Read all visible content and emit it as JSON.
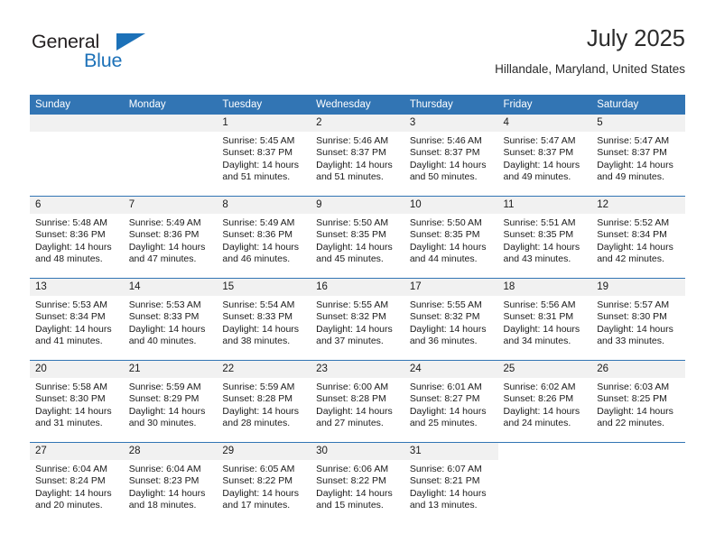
{
  "brand": {
    "name_part1": "General",
    "name_part2": "Blue",
    "triangle_icon": "triangle-icon",
    "accent_color": "#1c71b8"
  },
  "header": {
    "title": "July 2025",
    "subtitle": "Hillandale, Maryland, United States"
  },
  "calendar": {
    "header_bg": "#3275b4",
    "daynum_bg": "#f1f1f1",
    "weekdays": [
      "Sunday",
      "Monday",
      "Tuesday",
      "Wednesday",
      "Thursday",
      "Friday",
      "Saturday"
    ],
    "weeks": [
      [
        {
          "day": "",
          "sunrise": "",
          "sunset": "",
          "daylight": "",
          "empty": true
        },
        {
          "day": "",
          "sunrise": "",
          "sunset": "",
          "daylight": "",
          "empty": true
        },
        {
          "day": "1",
          "sunrise": "Sunrise: 5:45 AM",
          "sunset": "Sunset: 8:37 PM",
          "daylight": "Daylight: 14 hours and 51 minutes."
        },
        {
          "day": "2",
          "sunrise": "Sunrise: 5:46 AM",
          "sunset": "Sunset: 8:37 PM",
          "daylight": "Daylight: 14 hours and 51 minutes."
        },
        {
          "day": "3",
          "sunrise": "Sunrise: 5:46 AM",
          "sunset": "Sunset: 8:37 PM",
          "daylight": "Daylight: 14 hours and 50 minutes."
        },
        {
          "day": "4",
          "sunrise": "Sunrise: 5:47 AM",
          "sunset": "Sunset: 8:37 PM",
          "daylight": "Daylight: 14 hours and 49 minutes."
        },
        {
          "day": "5",
          "sunrise": "Sunrise: 5:47 AM",
          "sunset": "Sunset: 8:37 PM",
          "daylight": "Daylight: 14 hours and 49 minutes."
        }
      ],
      [
        {
          "day": "6",
          "sunrise": "Sunrise: 5:48 AM",
          "sunset": "Sunset: 8:36 PM",
          "daylight": "Daylight: 14 hours and 48 minutes."
        },
        {
          "day": "7",
          "sunrise": "Sunrise: 5:49 AM",
          "sunset": "Sunset: 8:36 PM",
          "daylight": "Daylight: 14 hours and 47 minutes."
        },
        {
          "day": "8",
          "sunrise": "Sunrise: 5:49 AM",
          "sunset": "Sunset: 8:36 PM",
          "daylight": "Daylight: 14 hours and 46 minutes."
        },
        {
          "day": "9",
          "sunrise": "Sunrise: 5:50 AM",
          "sunset": "Sunset: 8:35 PM",
          "daylight": "Daylight: 14 hours and 45 minutes."
        },
        {
          "day": "10",
          "sunrise": "Sunrise: 5:50 AM",
          "sunset": "Sunset: 8:35 PM",
          "daylight": "Daylight: 14 hours and 44 minutes."
        },
        {
          "day": "11",
          "sunrise": "Sunrise: 5:51 AM",
          "sunset": "Sunset: 8:35 PM",
          "daylight": "Daylight: 14 hours and 43 minutes."
        },
        {
          "day": "12",
          "sunrise": "Sunrise: 5:52 AM",
          "sunset": "Sunset: 8:34 PM",
          "daylight": "Daylight: 14 hours and 42 minutes."
        }
      ],
      [
        {
          "day": "13",
          "sunrise": "Sunrise: 5:53 AM",
          "sunset": "Sunset: 8:34 PM",
          "daylight": "Daylight: 14 hours and 41 minutes."
        },
        {
          "day": "14",
          "sunrise": "Sunrise: 5:53 AM",
          "sunset": "Sunset: 8:33 PM",
          "daylight": "Daylight: 14 hours and 40 minutes."
        },
        {
          "day": "15",
          "sunrise": "Sunrise: 5:54 AM",
          "sunset": "Sunset: 8:33 PM",
          "daylight": "Daylight: 14 hours and 38 minutes."
        },
        {
          "day": "16",
          "sunrise": "Sunrise: 5:55 AM",
          "sunset": "Sunset: 8:32 PM",
          "daylight": "Daylight: 14 hours and 37 minutes."
        },
        {
          "day": "17",
          "sunrise": "Sunrise: 5:55 AM",
          "sunset": "Sunset: 8:32 PM",
          "daylight": "Daylight: 14 hours and 36 minutes."
        },
        {
          "day": "18",
          "sunrise": "Sunrise: 5:56 AM",
          "sunset": "Sunset: 8:31 PM",
          "daylight": "Daylight: 14 hours and 34 minutes."
        },
        {
          "day": "19",
          "sunrise": "Sunrise: 5:57 AM",
          "sunset": "Sunset: 8:30 PM",
          "daylight": "Daylight: 14 hours and 33 minutes."
        }
      ],
      [
        {
          "day": "20",
          "sunrise": "Sunrise: 5:58 AM",
          "sunset": "Sunset: 8:30 PM",
          "daylight": "Daylight: 14 hours and 31 minutes."
        },
        {
          "day": "21",
          "sunrise": "Sunrise: 5:59 AM",
          "sunset": "Sunset: 8:29 PM",
          "daylight": "Daylight: 14 hours and 30 minutes."
        },
        {
          "day": "22",
          "sunrise": "Sunrise: 5:59 AM",
          "sunset": "Sunset: 8:28 PM",
          "daylight": "Daylight: 14 hours and 28 minutes."
        },
        {
          "day": "23",
          "sunrise": "Sunrise: 6:00 AM",
          "sunset": "Sunset: 8:28 PM",
          "daylight": "Daylight: 14 hours and 27 minutes."
        },
        {
          "day": "24",
          "sunrise": "Sunrise: 6:01 AM",
          "sunset": "Sunset: 8:27 PM",
          "daylight": "Daylight: 14 hours and 25 minutes."
        },
        {
          "day": "25",
          "sunrise": "Sunrise: 6:02 AM",
          "sunset": "Sunset: 8:26 PM",
          "daylight": "Daylight: 14 hours and 24 minutes."
        },
        {
          "day": "26",
          "sunrise": "Sunrise: 6:03 AM",
          "sunset": "Sunset: 8:25 PM",
          "daylight": "Daylight: 14 hours and 22 minutes."
        }
      ],
      [
        {
          "day": "27",
          "sunrise": "Sunrise: 6:04 AM",
          "sunset": "Sunset: 8:24 PM",
          "daylight": "Daylight: 14 hours and 20 minutes."
        },
        {
          "day": "28",
          "sunrise": "Sunrise: 6:04 AM",
          "sunset": "Sunset: 8:23 PM",
          "daylight": "Daylight: 14 hours and 18 minutes."
        },
        {
          "day": "29",
          "sunrise": "Sunrise: 6:05 AM",
          "sunset": "Sunset: 8:22 PM",
          "daylight": "Daylight: 14 hours and 17 minutes."
        },
        {
          "day": "30",
          "sunrise": "Sunrise: 6:06 AM",
          "sunset": "Sunset: 8:22 PM",
          "daylight": "Daylight: 14 hours and 15 minutes."
        },
        {
          "day": "31",
          "sunrise": "Sunrise: 6:07 AM",
          "sunset": "Sunset: 8:21 PM",
          "daylight": "Daylight: 14 hours and 13 minutes."
        },
        {
          "day": "",
          "sunrise": "",
          "sunset": "",
          "daylight": "",
          "blank": true
        },
        {
          "day": "",
          "sunrise": "",
          "sunset": "",
          "daylight": "",
          "blank": true
        }
      ]
    ]
  }
}
